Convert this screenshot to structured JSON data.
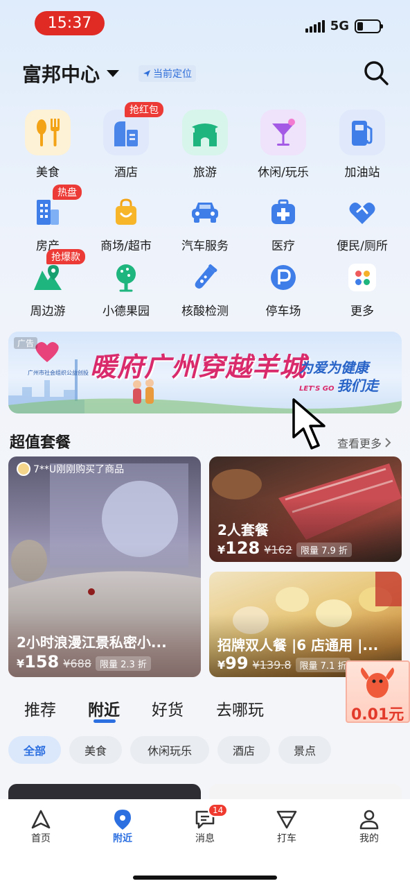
{
  "status_bar": {
    "time": "15:37",
    "network": "5G",
    "battery_level": 0.28
  },
  "header": {
    "location": "富邦中心",
    "current_location_label": "当前定位"
  },
  "categories": [
    {
      "label": "美食",
      "icon": "food-icon"
    },
    {
      "label": "酒店",
      "icon": "hotel-icon",
      "badge": "抢红包"
    },
    {
      "label": "旅游",
      "icon": "travel-icon"
    },
    {
      "label": "休闲/玩乐",
      "icon": "cocktail-icon"
    },
    {
      "label": "加油站",
      "icon": "gas-station-icon"
    },
    {
      "label": "房产",
      "icon": "building-icon",
      "badge": "热盘"
    },
    {
      "label": "商场/超市",
      "icon": "shopping-bag-icon"
    },
    {
      "label": "汽车服务",
      "icon": "car-icon"
    },
    {
      "label": "医疗",
      "icon": "medical-icon"
    },
    {
      "label": "便民/厕所",
      "icon": "handshake-icon"
    },
    {
      "label": "周边游",
      "icon": "map-pin-icon",
      "badge": "抢爆款"
    },
    {
      "label": "小德果园",
      "icon": "tree-icon"
    },
    {
      "label": "核酸检测",
      "icon": "test-tube-icon"
    },
    {
      "label": "停车场",
      "icon": "parking-icon"
    },
    {
      "label": "更多",
      "icon": "more-icon"
    }
  ],
  "banner": {
    "ad_label": "广告",
    "org": "广州市社会组织公益创投",
    "title": "暖府广州穿越羊城",
    "slogan": "为爱为健康",
    "slogan_en": "LET'S GO",
    "slogan2": "我们走"
  },
  "deals_section": {
    "title": "超值套餐",
    "more": "查看更多"
  },
  "deals": [
    {
      "title": "2小时浪漫江景私密小...",
      "currency": "¥",
      "price": "158",
      "original": "¥688",
      "discount": "限量 2.3 折",
      "buyer": "7**U刚刚购买了商品"
    },
    {
      "title": "2人套餐",
      "currency": "¥",
      "price": "128",
      "original": "¥162",
      "discount": "限量 7.9 折"
    },
    {
      "title": "招牌双人餐 |6 店通用 |...",
      "currency": "¥",
      "price": "99",
      "original": "¥139.8",
      "discount": "限量 7.1 折"
    }
  ],
  "tabs": [
    "推荐",
    "附近",
    "好货",
    "去哪玩"
  ],
  "active_tab": "附近",
  "promo": {
    "text": "0.01元"
  },
  "filters": [
    "全部",
    "美食",
    "休闲玩乐",
    "酒店",
    "景点"
  ],
  "bottom_nav": [
    {
      "label": "首页",
      "icon": "home-icon"
    },
    {
      "label": "附近",
      "icon": "location-pin-icon"
    },
    {
      "label": "消息",
      "icon": "message-icon",
      "badge": "14"
    },
    {
      "label": "打车",
      "icon": "taxi-icon"
    },
    {
      "label": "我的",
      "icon": "user-icon"
    }
  ],
  "colors": {
    "accent": "#2b6fe0",
    "badge": "#ec3b36",
    "status_time_bg": "#e02a24"
  }
}
